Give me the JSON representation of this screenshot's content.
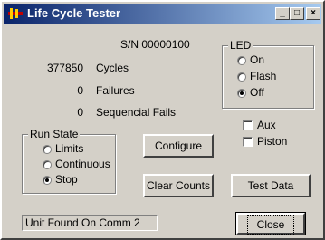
{
  "window": {
    "title": "Life Cycle Tester",
    "minimize_glyph": "_",
    "maximize_glyph": "□",
    "close_glyph": "×"
  },
  "serial": "S/N 00000100",
  "counters": [
    {
      "value": "377850",
      "label": "Cycles"
    },
    {
      "value": "0",
      "label": "Failures"
    },
    {
      "value": "0",
      "label": "Sequencial Fails"
    }
  ],
  "led_group": {
    "title": "LED",
    "options": [
      "On",
      "Flash",
      "Off"
    ],
    "selected": "Off"
  },
  "checkboxes": [
    {
      "label": "Aux",
      "checked": false
    },
    {
      "label": "Piston",
      "checked": false
    }
  ],
  "run_state": {
    "title": "Run State",
    "options": [
      "Limits",
      "Continuous",
      "Stop"
    ],
    "selected": "Stop"
  },
  "buttons": {
    "configure": "Configure",
    "clear_counts": "Clear Counts",
    "test_data": "Test Data",
    "close": "Close"
  },
  "status_text": "Unit Found On Comm 2",
  "colors": {
    "titlebar_start": "#0a246a",
    "titlebar_end": "#a6caf0",
    "face": "#d4d0c8"
  }
}
